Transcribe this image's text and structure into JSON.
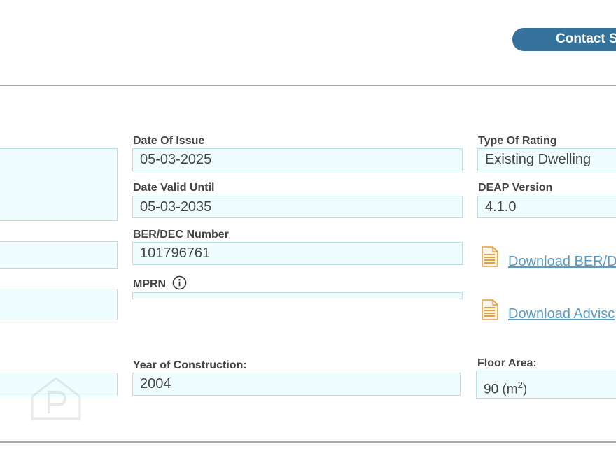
{
  "header": {
    "contact_label": "Contact S"
  },
  "fields": {
    "date_of_issue": {
      "label": "Date Of Issue",
      "value": "05-03-2025"
    },
    "date_valid_until": {
      "label": "Date Valid Until",
      "value": "05-03-2035"
    },
    "ber_dec_number": {
      "label": "BER/DEC Number",
      "value": "101796761"
    },
    "mprn": {
      "label": "MPRN",
      "value": ""
    },
    "year_of_construction": {
      "label": "Year of Construction:",
      "value": "2004"
    },
    "type_of_rating": {
      "label": "Type Of Rating",
      "value": "Existing Dwelling"
    },
    "deap_version": {
      "label": "DEAP Version",
      "value": "4.1.0"
    },
    "floor_area": {
      "label": "Floor Area:",
      "value": "90 (m",
      "unit_sup": "2",
      "value_suffix": ")"
    }
  },
  "downloads": {
    "ber": {
      "label": "Download BER/D"
    },
    "advisory": {
      "label": "Download Advisc"
    }
  },
  "colors": {
    "button_bg": "#35739c",
    "field_bg": "#f0fdfe",
    "field_border": "#b8dde3",
    "link": "#5a9bc4",
    "doc_icon": "#e0a040"
  }
}
